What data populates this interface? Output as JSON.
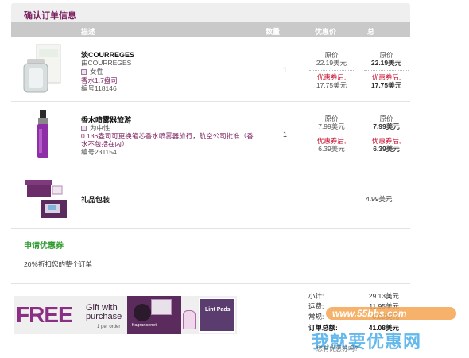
{
  "header": {
    "title": "确认订单信息"
  },
  "columns": {
    "description": "描述",
    "quantity": "数量",
    "discount_price": "优惠价",
    "total": "总"
  },
  "items": [
    {
      "name": "淡COURREGES",
      "brand": "由COURREGES",
      "gender": "女性",
      "size": "香水1.7盎司",
      "item_no": "编号118146",
      "qty": "1",
      "orig_label": "原价",
      "orig_price": "22.19美元",
      "coupon_label": "优惠券后,",
      "coupon_price": "17.75美元",
      "total_orig_label": "原价",
      "total_orig": "22.19美元",
      "total_coupon_label": "优惠券后,",
      "total_coupon": "17.75美元"
    },
    {
      "name": "香水喷雾器旅游",
      "gender": "为中性",
      "note": "0.136盎司可更换笔芯香水喷雾器旅行，航空公司批准（香",
      "note2": "水不包括在内）",
      "item_no": "编号231154",
      "qty": "1",
      "orig_label": "原价",
      "orig_price": "7.99美元",
      "coupon_label": "优惠券后,",
      "coupon_price": "6.39美元",
      "total_orig_label": "原价",
      "total_orig": "7.99美元",
      "total_coupon_label": "优惠券后,",
      "total_coupon": "6.39美元"
    }
  ],
  "gift": {
    "label": "礼品包装",
    "price": "4.99美元"
  },
  "coupon": {
    "title": "申请优惠券",
    "description": "20％折扣您的整个订单"
  },
  "banner": {
    "free": "FREE",
    "gift_with": "Gift with",
    "purchase": "purchase",
    "per_order": "1 per order",
    "brand": "fragrancenet",
    "pads": "Lint Pads"
  },
  "summary": {
    "subtotal_label": "小计:",
    "subtotal": "29.13美元",
    "shipping_label": "运费:",
    "shipping": "11.95美元",
    "standard_label": "常规:",
    "standard": "0.00美元",
    "total_label": "订单总额:",
    "total": "41.08美元",
    "footer_link": "您有优惠券吗?"
  },
  "watermark": {
    "url": "www.55bbs.com",
    "cn": "我就要优惠网"
  },
  "colors": {
    "accent": "#7a1e5e",
    "price_red": "#c8102e",
    "coupon_green": "#2e9a2e",
    "header_gray": "#c9c9c9"
  }
}
